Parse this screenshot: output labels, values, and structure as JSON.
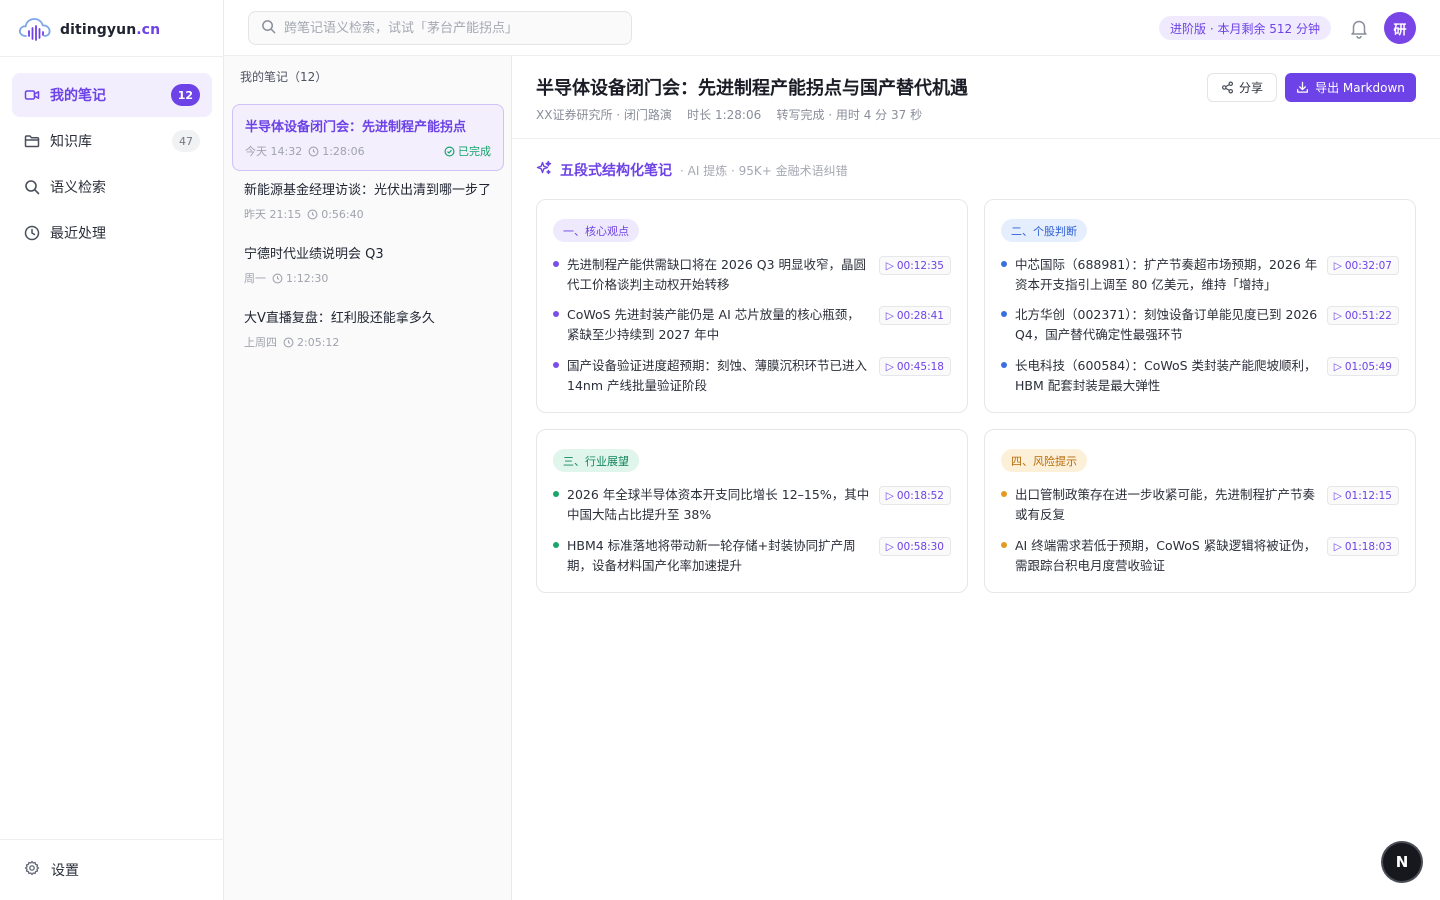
{
  "brand": {
    "name": "ditingyun",
    "domain": ".cn",
    "accent": "#6d42e6"
  },
  "nav": [
    {
      "label": "我的笔记",
      "badge": "12",
      "icon": "video-icon",
      "active": true
    },
    {
      "label": "知识库",
      "badge": "47",
      "icon": "folder-icon",
      "active": false
    },
    {
      "label": "语义检索",
      "badge": "",
      "icon": "search-icon",
      "active": false
    },
    {
      "label": "最近处理",
      "badge": "",
      "icon": "clock-icon",
      "active": false
    }
  ],
  "settings_label": "设置",
  "search": {
    "placeholder": "跨笔记语义检索，试试「茅台产能拐点」"
  },
  "quota": "进阶版 · 本月剩余 512 分钟",
  "avatar": "研",
  "notes_header": "我的笔记（12）",
  "notes": [
    {
      "title": "半导体设备闭门会：先进制程产能拐点",
      "date": "今天 14:32",
      "duration": "1:28:06",
      "status": "已完成"
    },
    {
      "title": "新能源基金经理访谈：光伏出清到哪一步了",
      "date": "昨天 21:15",
      "duration": "0:56:40"
    },
    {
      "title": "宁德时代业绩说明会 Q3",
      "date": "周一",
      "duration": "1:12:30"
    },
    {
      "title": "大V直播复盘：红利股还能拿多久",
      "date": "上周四",
      "duration": "2:05:12"
    }
  ],
  "detail": {
    "title": "半导体设备闭门会：先进制程产能拐点与国产替代机遇",
    "meta": "XX证券研究所 · 闭门路演    时长 1:28:06    转写完成 · 用时 4 分 37 秒",
    "share_label": "分享",
    "export_label": "导出 Markdown",
    "section_title": "五段式结构化笔记",
    "section_sub": "· AI 提炼 · 95K+ 金融术语纠错",
    "cards": [
      {
        "tag": "一、核心观点",
        "color": "purple",
        "points": [
          {
            "text": "先进制程产能供需缺口将在 2026 Q3 明显收窄，晶圆代工价格谈判主动权开始转移",
            "time": "00:12:35"
          },
          {
            "text": "CoWoS 先进封装产能仍是 AI 芯片放量的核心瓶颈，紧缺至少持续到 2027 年中",
            "time": "00:28:41"
          },
          {
            "text": "国产设备验证进度超预期：刻蚀、薄膜沉积环节已进入 14nm 产线批量验证阶段",
            "time": "00:45:18"
          }
        ]
      },
      {
        "tag": "二、个股判断",
        "color": "blue",
        "points": [
          {
            "text": "中芯国际（688981）：扩产节奏超市场预期，2026 年资本开支指引上调至 80 亿美元，维持「增持」",
            "time": "00:32:07"
          },
          {
            "text": "北方华创（002371）：刻蚀设备订单能见度已到 2026 Q4，国产替代确定性最强环节",
            "time": "00:51:22"
          },
          {
            "text": "长电科技（600584）：CoWoS 类封装产能爬坡顺利，HBM 配套封装是最大弹性",
            "time": "01:05:49"
          }
        ]
      },
      {
        "tag": "三、行业展望",
        "color": "green",
        "points": [
          {
            "text": "2026 年全球半导体资本开支同比增长 12–15%，其中中国大陆占比提升至 38%",
            "time": "00:18:52"
          },
          {
            "text": "HBM4 标准落地将带动新一轮存储+封装协同扩产周期，设备材料国产化率加速提升",
            "time": "00:58:30"
          }
        ]
      },
      {
        "tag": "四、风险提示",
        "color": "orange",
        "points": [
          {
            "text": "出口管制政策存在进一步收紧可能，先进制程扩产节奏或有反复",
            "time": "01:12:15"
          },
          {
            "text": "AI 终端需求若低于预期，CoWoS 紧缺逻辑将被证伪，需跟踪台积电月度营收验证",
            "time": "01:18:03"
          }
        ]
      }
    ]
  },
  "fab_label": "N"
}
